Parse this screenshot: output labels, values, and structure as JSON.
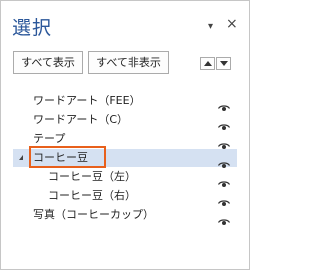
{
  "pane": {
    "title": "選択",
    "menu_glyph": "▾",
    "close_glyph": "×"
  },
  "toolbar": {
    "show_all": "すべて表示",
    "hide_all": "すべて非表示"
  },
  "items": [
    {
      "label": "ワードアート（FEE）",
      "indent": 1
    },
    {
      "label": "ワードアート（C）",
      "indent": 1
    },
    {
      "label": "テープ",
      "indent": 1
    },
    {
      "label": "コーヒー豆",
      "indent": 1,
      "selected": true,
      "expanded": true
    },
    {
      "label": "コーヒー豆（左）",
      "indent": 2
    },
    {
      "label": "コーヒー豆（右）",
      "indent": 2
    },
    {
      "label": "写真（コーヒーカップ）",
      "indent": 1
    }
  ],
  "colors": {
    "title": "#2b579a",
    "selection": "#d5e1f2",
    "highlight_border": "#e8601c"
  }
}
